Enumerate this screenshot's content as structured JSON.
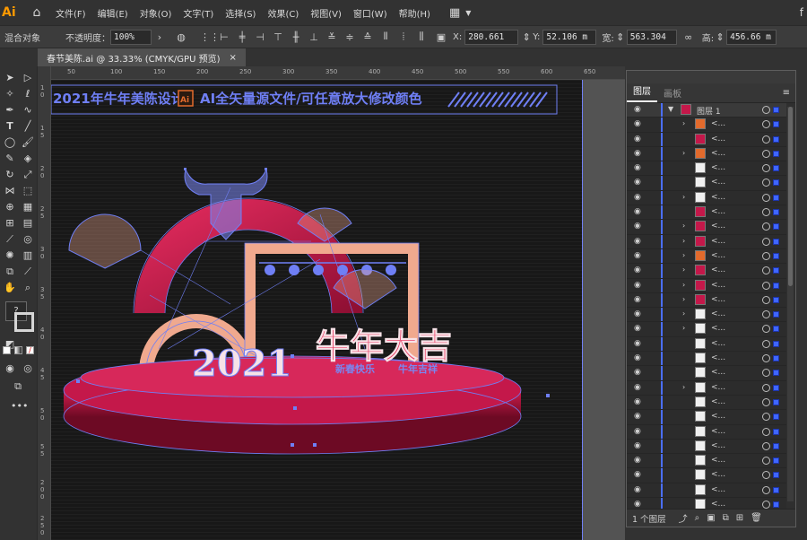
{
  "app": {
    "logo": "Ai",
    "home_icon": "home-icon",
    "workspace_icon": "workspace-switcher-icon",
    "right_glyph": "f"
  },
  "menu": [
    "文件(F)",
    "编辑(E)",
    "对象(O)",
    "文字(T)",
    "选择(S)",
    "效果(C)",
    "视图(V)",
    "窗口(W)",
    "帮助(H)"
  ],
  "control": {
    "object_label": "混合对象",
    "opacity_label": "不透明度：",
    "opacity_value": "100%",
    "x_label": "X:",
    "x_value": "280.661",
    "y_label": "Y:",
    "y_value": "52.106 m",
    "w_label": "宽:",
    "w_value": "563.304",
    "h_label": "高:",
    "h_value": "456.66 m"
  },
  "doc_tab": {
    "title": "春节美陈.ai @ 33.33% (CMYK/GPU 预览)",
    "close": "×"
  },
  "ruler_h": [
    "50",
    "100",
    "150",
    "200",
    "250",
    "300",
    "350",
    "400",
    "450",
    "500",
    "550",
    "600",
    "650"
  ],
  "ruler_v": [
    "1 0",
    "1 5",
    "2 0",
    "2 5",
    "3 0",
    "3 5",
    "4 0",
    "4 5",
    "5 0",
    "5 5",
    "2 0 0",
    "2 5 0"
  ],
  "artwork": {
    "banner_left": "2021年牛年美陈设计",
    "banner_icon": "Ai",
    "banner_right": "AI全矢量源文件/可任意放大修改颜色",
    "year": "2021",
    "slogan": "牛年大吉",
    "sub_left": "新春快乐",
    "sub_right": "牛年吉祥",
    "colors": {
      "red": "#c4184a",
      "pink": "#f0a98e",
      "outline": "#6f7ff5",
      "dark": "#181818"
    }
  },
  "layers_panel": {
    "tab_layers": "图层",
    "tab_artboards": "画板",
    "top_layer": "图层 1",
    "row_name": "<...",
    "row_count": 27,
    "footer_count": "1 个图层"
  }
}
